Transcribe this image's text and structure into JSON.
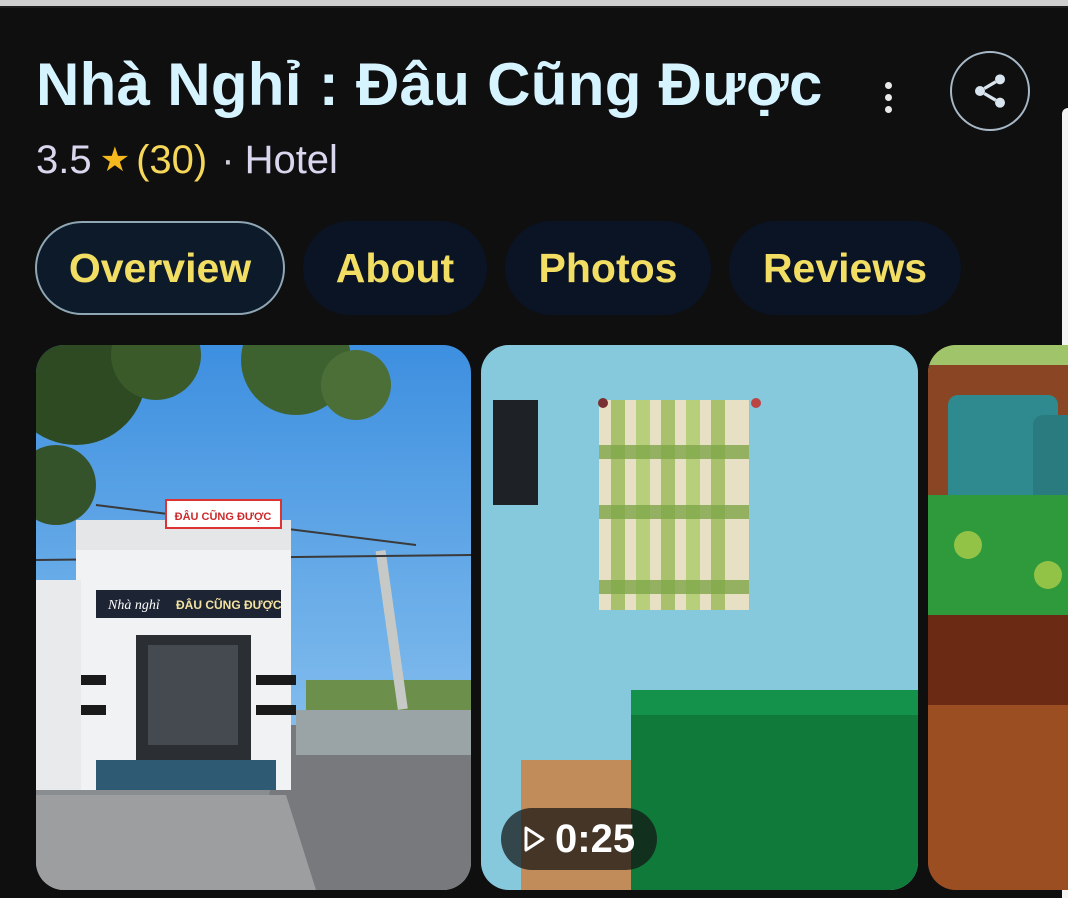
{
  "place": {
    "name": "Nhà Nghỉ : Đâu Cũng Được",
    "rating": "3.5",
    "review_count": "(30)",
    "separator": "·",
    "category": "Hotel"
  },
  "tabs": [
    {
      "label": "Overview",
      "active": true
    },
    {
      "label": "About",
      "active": false
    },
    {
      "label": "Photos",
      "active": false
    },
    {
      "label": "Reviews",
      "active": false
    }
  ],
  "photos": {
    "photo1": {
      "sign_line1": "Nhà nghỉ",
      "sign_line2": "ĐÂU CŨNG ĐƯỢC"
    },
    "photo2": {
      "video_duration": "0:25"
    }
  },
  "icons": {
    "more": "more-vert-icon",
    "share": "share-icon",
    "star": "star-icon",
    "play": "play-icon"
  },
  "colors": {
    "title": "#d6f4ff",
    "tab_text": "#f3de64",
    "star": "#f5b81d",
    "background": "#0f0f10"
  }
}
